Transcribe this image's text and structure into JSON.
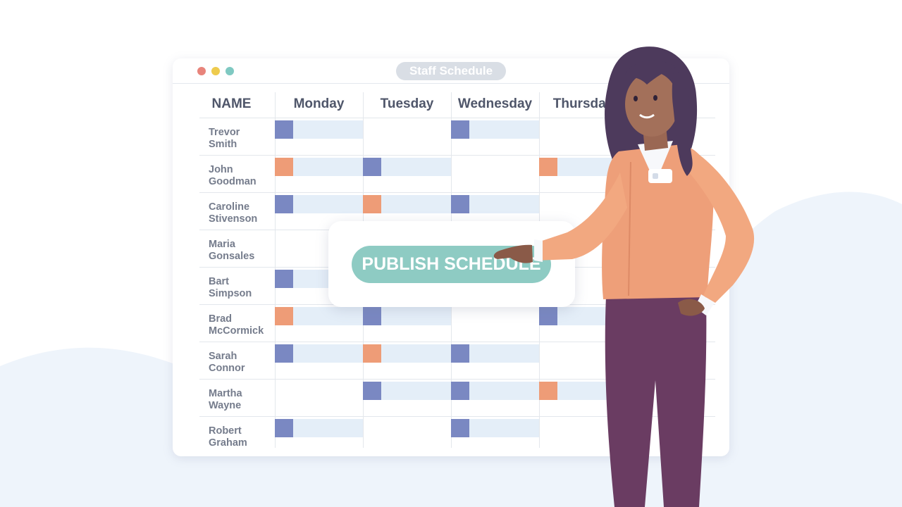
{
  "window": {
    "title": "Staff Schedule"
  },
  "schedule": {
    "name_header": "NAME",
    "days": [
      "Monday",
      "Tuesday",
      "Wednesday",
      "Thursday"
    ],
    "employees": [
      {
        "name_line1": "Trevor",
        "name_line2": "Smith",
        "shifts": [
          "blue",
          null,
          "blue",
          null,
          "none"
        ]
      },
      {
        "name_line1": "John",
        "name_line2": "Goodman",
        "shifts": [
          "orange",
          "blue",
          null,
          "orange",
          "none"
        ]
      },
      {
        "name_line1": "Caroline",
        "name_line2": "Stivenson",
        "shifts": [
          "blue",
          "orange",
          "blue",
          null,
          "none"
        ]
      },
      {
        "name_line1": "Maria",
        "name_line2": "Gonsales",
        "shifts": [
          null,
          null,
          null,
          null,
          "none"
        ]
      },
      {
        "name_line1": "Bart",
        "name_line2": "Simpson",
        "shifts": [
          "blue",
          null,
          null,
          null,
          "none"
        ]
      },
      {
        "name_line1": "Brad",
        "name_line2": "McCormick",
        "shifts": [
          "orange",
          "blue",
          null,
          "blue",
          "none"
        ]
      },
      {
        "name_line1": "Sarah",
        "name_line2": "Connor",
        "shifts": [
          "blue",
          "orange",
          "blue",
          null,
          "none"
        ]
      },
      {
        "name_line1": "Martha",
        "name_line2": "Wayne",
        "shifts": [
          null,
          "blue",
          "blue",
          "orange",
          "none"
        ]
      },
      {
        "name_line1": "Robert",
        "name_line2": "Graham",
        "shifts": [
          "blue",
          null,
          "blue",
          null,
          "none"
        ]
      }
    ]
  },
  "publish": {
    "label": "PUBLISH SCHEDULE"
  },
  "colors": {
    "shift_blue": "#7a88c2",
    "shift_orange": "#ee9c77",
    "shift_bar": "#e4eef8",
    "publish_button": "#8ecbc3",
    "background_hills": "#eef4fb"
  }
}
